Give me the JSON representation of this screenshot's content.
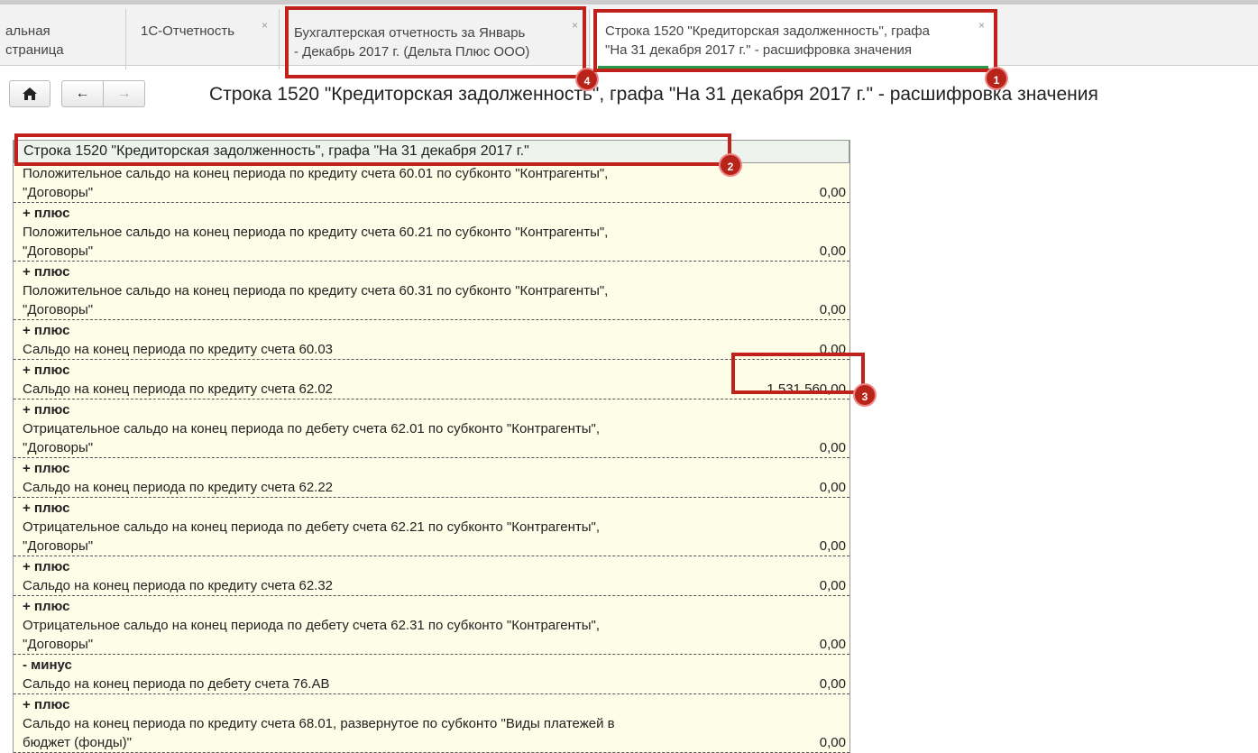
{
  "tabs": [
    {
      "label": "альная страница",
      "closable": false
    },
    {
      "label": "1С-Отчетность",
      "closable": true
    },
    {
      "label": "Бухгалтерская отчетность за Январь\n- Декабрь 2017 г. (Дельта Плюс ООО)",
      "closable": true
    },
    {
      "label": "Строка 1520 \"Кредиторская задолженность\", графа\n\"На 31 декабря 2017 г.\" - расшифровка значения",
      "closable": true,
      "active": true
    }
  ],
  "close_glyph": "×",
  "nav": {
    "home": "home-icon",
    "back": "←",
    "forward": "→"
  },
  "page_title": "Строка 1520 \"Кредиторская задолженность\", графа \"На 31 декабря 2017 г.\" - расшифровка значения",
  "table": {
    "header": "Строка 1520 \"Кредиторская задолженность\", графа \"На 31 декабря 2017 г.\"",
    "rows": [
      {
        "op": "",
        "text": "Положительное сальдо на конец периода по кредиту счета 60.01 по субконто \"Контрагенты\",\n\"Договоры\"",
        "value": "0,00"
      },
      {
        "op": "+ плюс",
        "text": "Положительное сальдо на конец периода по кредиту счета 60.21 по субконто \"Контрагенты\",\n\"Договоры\"",
        "value": "0,00"
      },
      {
        "op": "+ плюс",
        "text": "Положительное сальдо на конец периода по кредиту счета 60.31 по субконто \"Контрагенты\",\n\"Договоры\"",
        "value": "0,00"
      },
      {
        "op": "+ плюс",
        "text": "Сальдо на конец периода по кредиту счета 60.03",
        "value": "0,00"
      },
      {
        "op": "+ плюс",
        "text": "Сальдо на конец периода по кредиту счета 62.02",
        "value": "1 531 560,00"
      },
      {
        "op": "+ плюс",
        "text": "Отрицательное сальдо на конец периода по дебету счета 62.01 по субконто \"Контрагенты\",\n\"Договоры\"",
        "value": "0,00"
      },
      {
        "op": "+ плюс",
        "text": "Сальдо на конец периода по кредиту счета 62.22",
        "value": "0,00"
      },
      {
        "op": "+ плюс",
        "text": "Отрицательное сальдо на конец периода по дебету счета 62.21 по субконто \"Контрагенты\",\n\"Договоры\"",
        "value": "0,00"
      },
      {
        "op": "+ плюс",
        "text": "Сальдо на конец периода по кредиту счета 62.32",
        "value": "0,00"
      },
      {
        "op": "+ плюс",
        "text": "Отрицательное сальдо на конец периода по дебету счета 62.31 по субконто \"Контрагенты\",\n\"Договоры\"",
        "value": "0,00"
      },
      {
        "op": "- минус",
        "text": "Сальдо на конец периода по дебету счета 76.АВ",
        "value": "0,00"
      },
      {
        "op": "+ плюс",
        "text": "Сальдо на конец периода по кредиту счета 68.01, развернутое по субконто \"Виды платежей в\nбюджет (фонды)\"",
        "value": "0,00"
      }
    ]
  },
  "annotations": [
    "1",
    "2",
    "3",
    "4"
  ],
  "colors": {
    "annotation": "#c0211a",
    "active_tab_underline": "#2a9a4a",
    "table_bg": "#fdfde8"
  }
}
